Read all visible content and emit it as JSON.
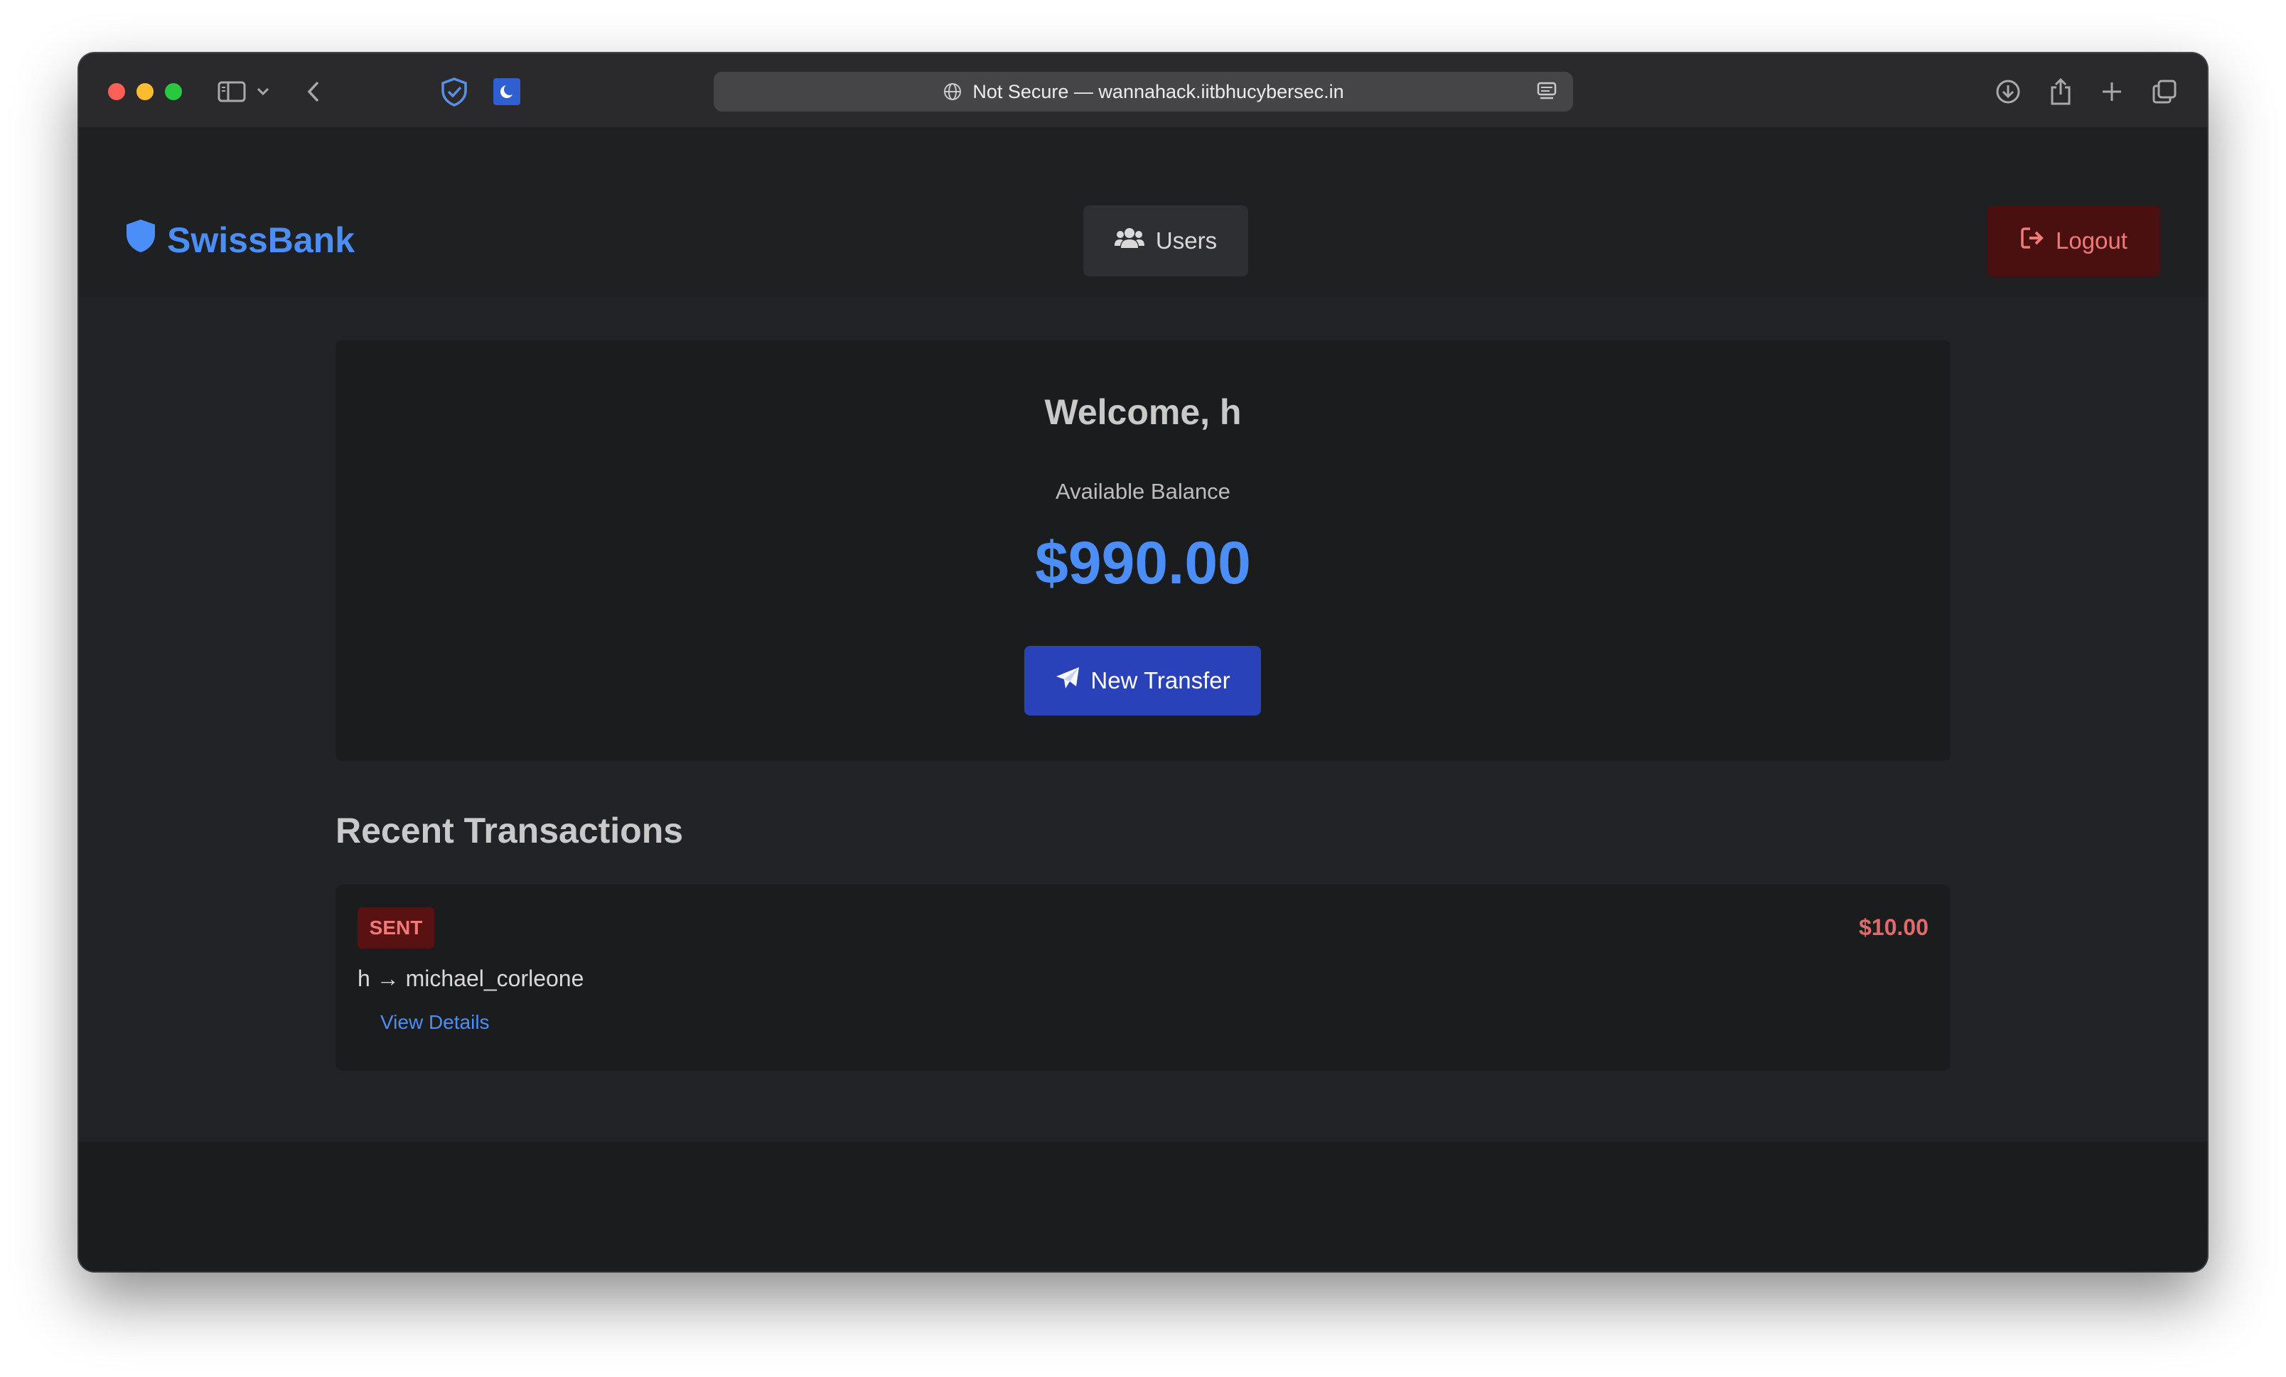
{
  "browser": {
    "address_text": "Not Secure — wannahack.iitbhucybersec.in"
  },
  "navbar": {
    "brand": "SwissBank",
    "users_label": "Users",
    "logout_label": "Logout"
  },
  "account": {
    "welcome": "Welcome, h",
    "balance_label": "Available Balance",
    "balance_value": "$990.00",
    "transfer_label": "New Transfer"
  },
  "transactions": {
    "title": "Recent Transactions",
    "items": [
      {
        "type": "SENT",
        "amount": "$10.00",
        "parties": "h → michael_corleone",
        "link": "View Details"
      }
    ]
  },
  "colors": {
    "accent": "#4c8ef7",
    "primary_button": "#2a42b9",
    "danger": "#e06b6b"
  },
  "icons": [
    "sidebar-icon",
    "chevron-down-icon",
    "back-icon",
    "shield-check-icon",
    "moon-icon",
    "globe-icon",
    "reader-icon",
    "download-icon",
    "share-icon",
    "plus-icon",
    "tabs-icon",
    "shield-icon",
    "users-icon",
    "logout-icon",
    "paper-plane-icon"
  ]
}
